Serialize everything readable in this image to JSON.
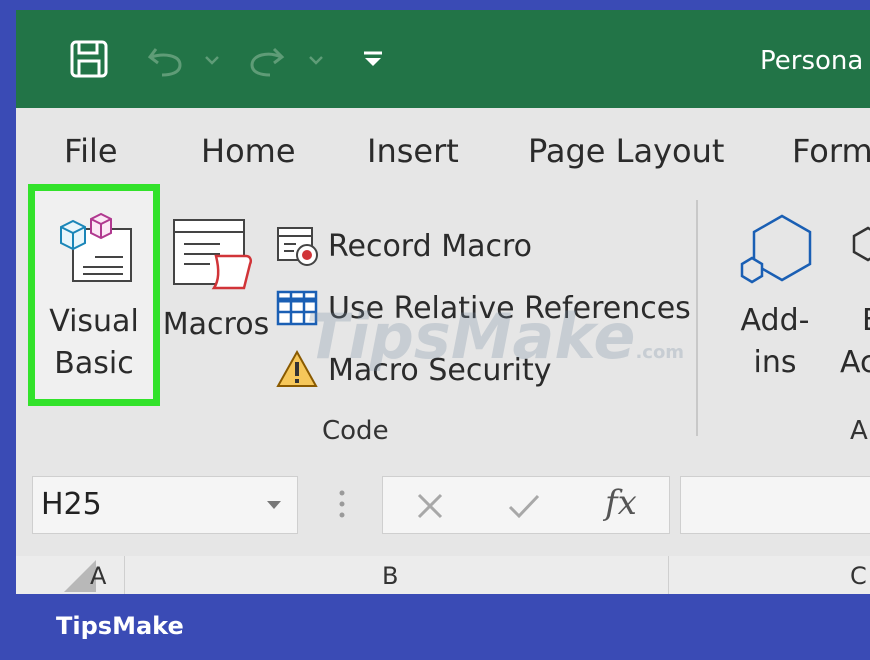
{
  "app": {
    "title_partial": "Persona"
  },
  "colors": {
    "titlebar": "#227447",
    "ribbon": "#e6e6e6",
    "highlight": "#32e22a",
    "frame": "#3a4bb5"
  },
  "qat": {
    "icons": [
      "save-icon",
      "undo-icon",
      "redo-icon",
      "customize-qat-icon"
    ]
  },
  "tabs": [
    "File",
    "Home",
    "Insert",
    "Page Layout",
    "Form"
  ],
  "code_group": {
    "visual_basic_line1": "Visual",
    "visual_basic_line2": "Basic",
    "macros": "Macros",
    "record_macro": "Record Macro",
    "relative_refs": "Use Relative References",
    "macro_security": "Macro Security",
    "label": "Code"
  },
  "addins_group": {
    "addins_line1": "Add-",
    "addins_line2": "ins",
    "partial_line1": "E",
    "partial_line2": "Ac",
    "partial_label": "A"
  },
  "formula_bar": {
    "name_box": "H25",
    "fx": "fx"
  },
  "columns": [
    "A",
    "B",
    "C"
  ],
  "watermark": {
    "main": "TipsMake",
    "suffix": ".com"
  },
  "footer": {
    "brand": "TipsMake"
  }
}
